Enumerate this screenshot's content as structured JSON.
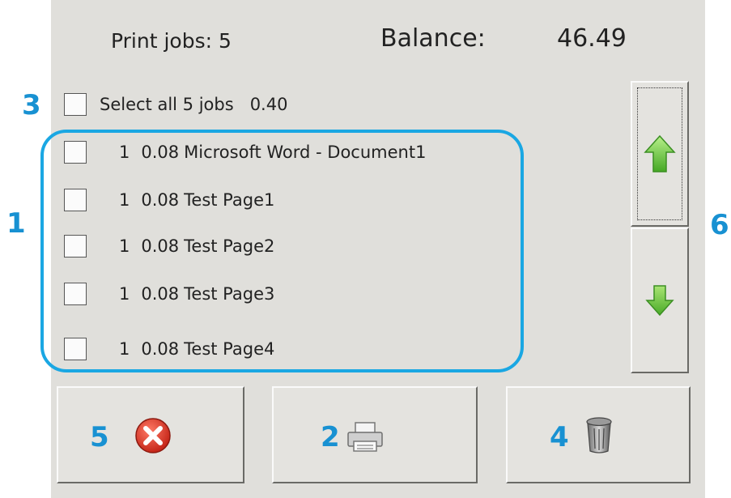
{
  "header": {
    "print_jobs_label": "Print jobs: 5",
    "balance_label": "Balance:",
    "balance_value": "46.49"
  },
  "select_all": {
    "label": "Select all 5 jobs   0.40",
    "checked": false
  },
  "jobs": [
    {
      "count": "1",
      "cost": "0.08",
      "name": "Microsoft Word - Document1",
      "checked": false
    },
    {
      "count": "1",
      "cost": "0.08",
      "name": "Test Page1",
      "checked": false
    },
    {
      "count": "1",
      "cost": "0.08",
      "name": "Test Page2",
      "checked": false
    },
    {
      "count": "1",
      "cost": "0.08",
      "name": "Test Page3",
      "checked": false
    },
    {
      "count": "1",
      "cost": "0.08",
      "name": "Test Page4",
      "checked": false
    }
  ],
  "callouts": {
    "job_list": "1",
    "print": "2",
    "select_all": "3",
    "delete": "4",
    "cancel": "5",
    "scroll": "6"
  },
  "icons": {
    "scroll_up": "arrow-up-icon",
    "scroll_down": "arrow-down-icon",
    "cancel": "cancel-x-icon",
    "print": "printer-icon",
    "delete": "trash-can-icon"
  },
  "colors": {
    "panel_background": "#e0dfdb",
    "callout_blue": "#1891d2",
    "group_frame": "#1aa7e3",
    "arrow_green": "#5ec03a",
    "cancel_red": "#d23324"
  }
}
